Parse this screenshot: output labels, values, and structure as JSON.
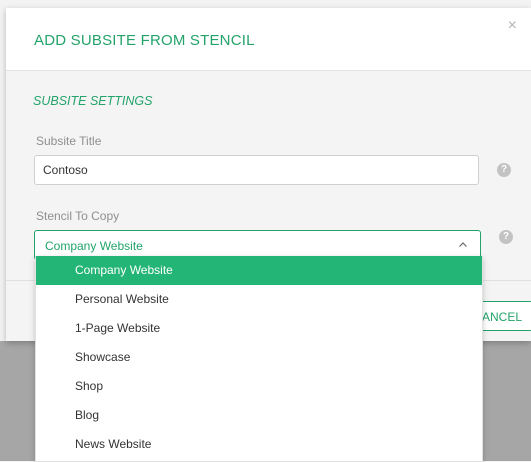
{
  "modal": {
    "title": "ADD SUBSITE FROM STENCIL",
    "close_label": "×",
    "section_title": "SUBSITE SETTINGS"
  },
  "form": {
    "subsite_title_label": "Subsite Title",
    "subsite_title_value": "Contoso",
    "stencil_label": "Stencil To Copy",
    "stencil_selected": "Company Website",
    "help_label": "?"
  },
  "dropdown": {
    "options": [
      "Company Website",
      "Personal Website",
      "1-Page Website",
      "Showcase",
      "Shop",
      "Blog",
      "News Website"
    ],
    "selected_index": 0
  },
  "footer": {
    "cancel_label": "CANCEL"
  },
  "colors": {
    "accent": "#23a36a",
    "selected_bg": "#23b575",
    "backdrop": "#a6a6a6"
  },
  "icons": {
    "close": "close-icon",
    "help": "help-icon",
    "chevron": "chevron-up-icon"
  }
}
